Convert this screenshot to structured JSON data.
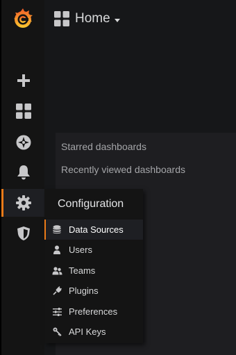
{
  "header": {
    "title": "Home"
  },
  "panel": {
    "starred": "Starred dashboards",
    "recent": "Recently viewed dashboards"
  },
  "config_menu": {
    "title": "Configuration",
    "items": [
      {
        "label": "Data Sources",
        "icon": "database-icon",
        "active": true
      },
      {
        "label": "Users",
        "icon": "user-icon"
      },
      {
        "label": "Teams",
        "icon": "team-icon"
      },
      {
        "label": "Plugins",
        "icon": "plug-icon"
      },
      {
        "label": "Preferences",
        "icon": "sliders-icon"
      },
      {
        "label": "API Keys",
        "icon": "key-icon"
      }
    ]
  },
  "sidebar": {
    "icons": [
      "grafana-logo",
      "plus-icon",
      "dashboards-icon",
      "compass-icon",
      "bell-icon",
      "gear-icon",
      "shield-icon"
    ],
    "active": "gear-icon"
  },
  "colors": {
    "accent": "#eb7b18",
    "background": "#161719",
    "sidebar": "#141414",
    "panel": "#1e1e21"
  }
}
